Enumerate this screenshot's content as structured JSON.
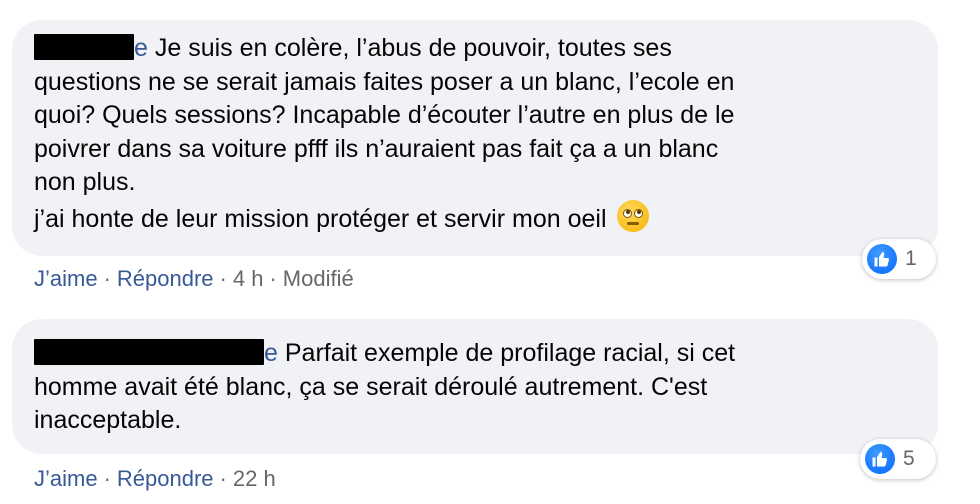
{
  "comments": [
    {
      "lines": [
        "Je suis en colère, l’abus de pouvoir, toutes ses",
        "questions ne se serait jamais faites poser a un blanc, l’ecole en",
        "quoi? Quels sessions? Incapable d’écouter l’autre en plus de le",
        "poivrer dans sa voiture pfff ils n’auraient pas fait ça a un blanc",
        "non plus.",
        "j’ai honte de leur mission protéger et servir mon oeil"
      ],
      "name_tail": "e",
      "emoji": "rolling-eyes-emoji",
      "actions": {
        "like": "J’aime",
        "reply": "Répondre",
        "time": "4 h",
        "edited": "Modifié"
      },
      "reaction": {
        "icon": "like-icon",
        "count": "1"
      }
    },
    {
      "lines": [
        "Parfait exemple de profilage racial, si cet",
        "homme avait été blanc, ça se serait déroulé autrement. C'est",
        "inacceptable."
      ],
      "name_tail": "e",
      "actions": {
        "like": "J’aime",
        "reply": "Répondre",
        "time": "22 h"
      },
      "reaction": {
        "icon": "like-icon",
        "count": "5"
      }
    }
  ],
  "colors": {
    "bubble": "#f0f2f5",
    "link": "#385898",
    "meta": "#65676b",
    "like": "#0866ff"
  },
  "separator": "·"
}
